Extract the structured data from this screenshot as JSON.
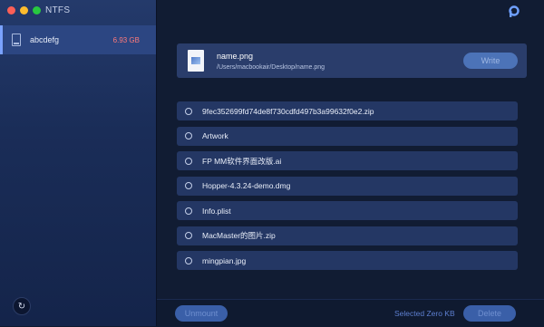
{
  "window": {
    "title": "NTFS"
  },
  "sidebar": {
    "drives": [
      {
        "name": "abcdefg",
        "size": "6.93 GB"
      }
    ]
  },
  "header": {
    "logo_icon": "ntfs-logo-icon"
  },
  "file_panel": {
    "name": "name.png",
    "path": "/Users/macbookair/Desktop/name.png",
    "write_label": "Write"
  },
  "files": [
    "9fec352699fd74de8f730cdfd497b3a99632f0e2.zip",
    "Artwork",
    "FP MM软件界面改版.ai",
    "Hopper-4.3.24-demo.dmg",
    "Info.plist",
    "MacMaster的图片.zip",
    "mingpian.jpg"
  ],
  "footer": {
    "unmount_label": "Unmount",
    "selected_text": "Selected Zero KB",
    "delete_label": "Delete"
  },
  "colors": {
    "accent": "#4c73b8",
    "size_red": "#ff7a7a",
    "sidebar_bg": "#1a2d58"
  }
}
